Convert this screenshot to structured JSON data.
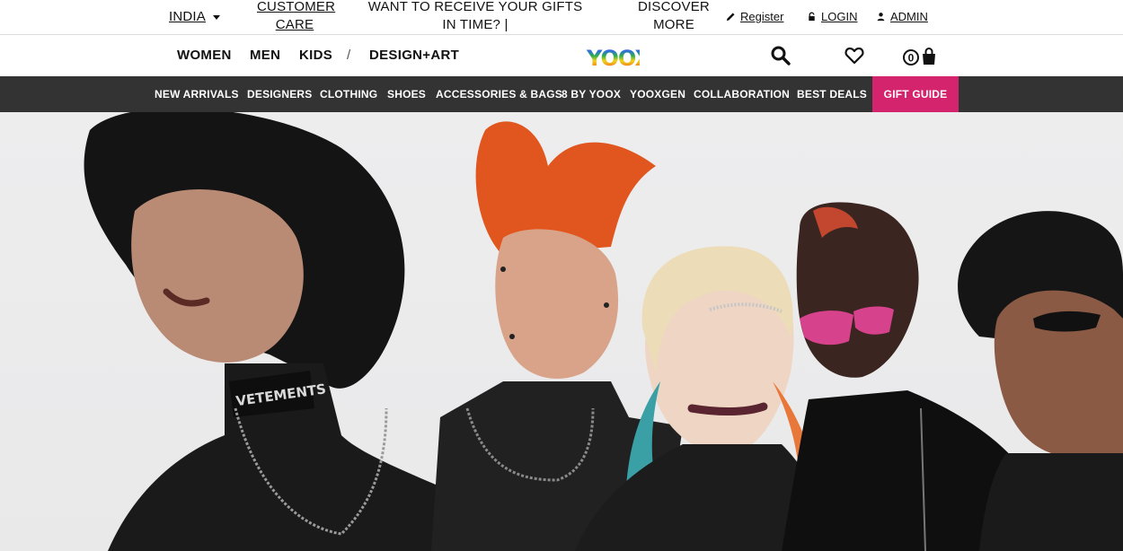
{
  "topbar": {
    "country": "INDIA",
    "customer_care": "CUSTOMER CARE",
    "promo": "WANT TO RECEIVE YOUR GIFTS IN TIME? |",
    "discover": "DISCOVER MORE",
    "register": "Register",
    "login": "LOGIN",
    "admin": "ADMIN"
  },
  "header": {
    "nav": [
      "WOMEN",
      "MEN",
      "KIDS",
      "/",
      "DESIGN+ART"
    ],
    "logo": "YOOX",
    "bag_count": "0"
  },
  "categories": [
    "NEW ARRIVALS",
    "DESIGNERS",
    "CLOTHING",
    "SHOES",
    "ACCESSORIES & BAGS",
    "8 BY YOOX",
    "YOOXGEN",
    "COLLABORATION",
    "BEST DEALS"
  ],
  "gift_guide": "GIFT GUIDE",
  "hero": {
    "collar_text": "VETEMENTS"
  },
  "colors": {
    "accent": "#d4246e",
    "catbar": "#333333"
  }
}
